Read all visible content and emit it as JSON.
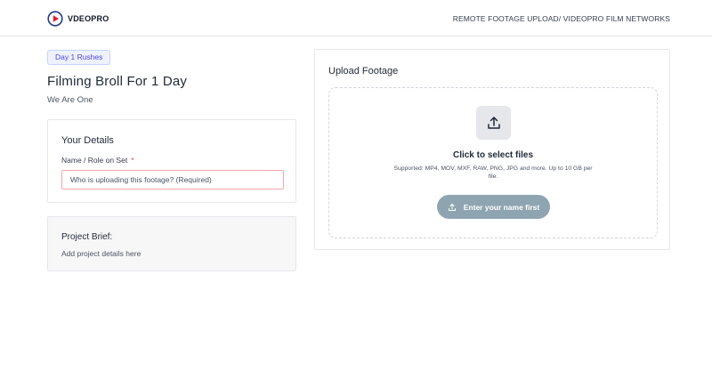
{
  "header": {
    "brand_name": "VDEOPRO",
    "page_title": "REMOTE FOOTAGE UPLOAD/ VIDEOPRO FILM NETWORKS"
  },
  "project": {
    "badge": "Day 1 Rushes",
    "title": "Filming Broll For 1 Day",
    "subtitle": "We Are One"
  },
  "details": {
    "title": "Your Details",
    "name_label": "Name / Role on Set",
    "required_mark": "*",
    "name_placeholder": "Who is uploading this footage? (Required)",
    "name_value": ""
  },
  "brief": {
    "title": "Project Brief:",
    "text": "Add project details here"
  },
  "upload": {
    "title": "Upload Footage",
    "click_text": "Click to select files",
    "supported_text": "Supported: MP4, MOV, MXF, RAW, PNG, JPG and more. Up to 10 GB per file.",
    "button_label": "Enter your name first"
  },
  "colors": {
    "logo_red": "#e11d2e",
    "logo_navy": "#1e3a8a",
    "badge_text": "#4f46e5",
    "badge_bg": "#eef2ff",
    "required": "#ef4444",
    "button_disabled": "#8fa4b1"
  },
  "icons": {
    "brand": "play-circle-icon",
    "upload": "upload-arrow-icon"
  }
}
